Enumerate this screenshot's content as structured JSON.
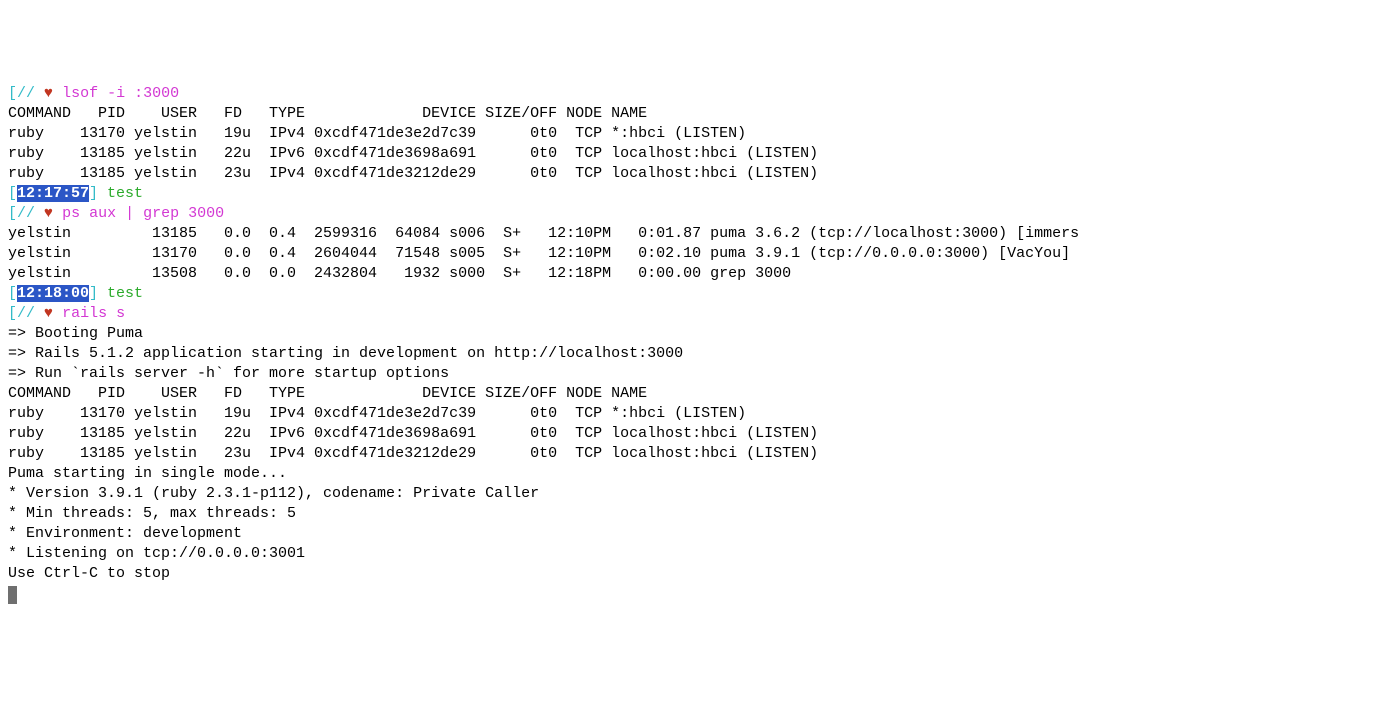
{
  "prompt_slashes": "[//",
  "heart": "♥",
  "close_bracket": "]",
  "test_label": " test",
  "cmd1": "lsof -i :3000",
  "lsof_header": "COMMAND   PID    USER   FD   TYPE             DEVICE SIZE/OFF NODE NAME",
  "lsof_rows": [
    "ruby    13170 yelstin   19u  IPv4 0xcdf471de3e2d7c39      0t0  TCP *:hbci (LISTEN)",
    "ruby    13185 yelstin   22u  IPv6 0xcdf471de3698a691      0t0  TCP localhost:hbci (LISTEN)",
    "ruby    13185 yelstin   23u  IPv4 0xcdf471de3212de29      0t0  TCP localhost:hbci (LISTEN)"
  ],
  "time1": "12:17:57",
  "cmd2": "ps aux | grep 3000",
  "ps_rows": [
    "yelstin         13185   0.0  0.4  2599316  64084 s006  S+   12:10PM   0:01.87 puma 3.6.2 (tcp://localhost:3000) [immers",
    "yelstin         13170   0.0  0.4  2604044  71548 s005  S+   12:10PM   0:02.10 puma 3.9.1 (tcp://0.0.0.0:3000) [VacYou]",
    "yelstin         13508   0.0  0.0  2432804   1932 s000  S+   12:18PM   0:00.00 grep 3000"
  ],
  "time2": "12:18:00",
  "cmd3": "rails s",
  "boot_lines": [
    "=> Booting Puma",
    "=> Rails 5.1.2 application starting in development on http://localhost:3000",
    "=> Run `rails server -h` for more startup options"
  ],
  "lsof_header2": "COMMAND   PID    USER   FD   TYPE             DEVICE SIZE/OFF NODE NAME",
  "lsof_rows2": [
    "ruby    13170 yelstin   19u  IPv4 0xcdf471de3e2d7c39      0t0  TCP *:hbci (LISTEN)",
    "ruby    13185 yelstin   22u  IPv6 0xcdf471de3698a691      0t0  TCP localhost:hbci (LISTEN)",
    "ruby    13185 yelstin   23u  IPv4 0xcdf471de3212de29      0t0  TCP localhost:hbci (LISTEN)"
  ],
  "puma_lines": [
    "Puma starting in single mode...",
    "* Version 3.9.1 (ruby 2.3.1-p112), codename: Private Caller",
    "* Min threads: 5, max threads: 5",
    "* Environment: development",
    "* Listening on tcp://0.0.0.0:3001",
    "Use Ctrl-C to stop"
  ]
}
